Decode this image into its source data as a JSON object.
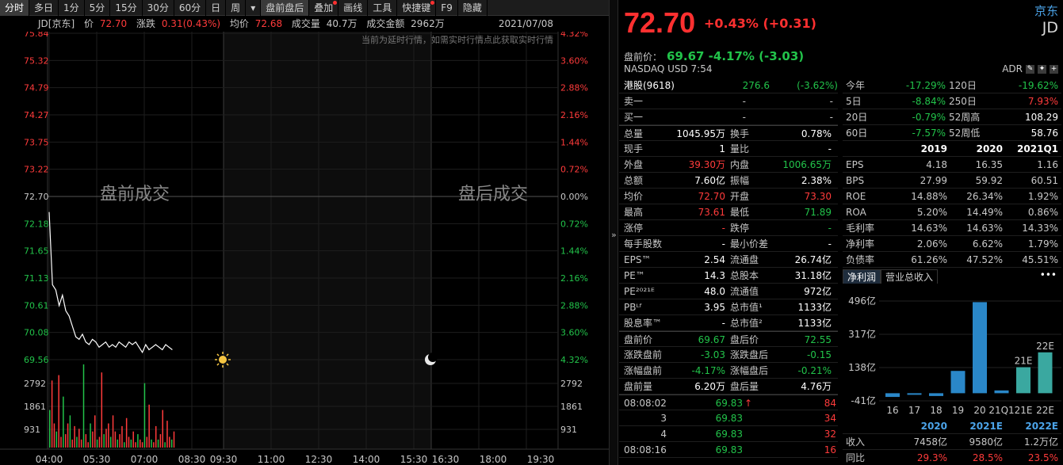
{
  "toolbar": {
    "items": [
      "分时",
      "多日",
      "1分",
      "5分",
      "15分",
      "30分",
      "60分",
      "日",
      "周",
      "▾",
      "盘前盘后",
      "叠加",
      "画线",
      "工具",
      "快捷键",
      "F9",
      "隐藏"
    ]
  },
  "info": {
    "symbol": "JD[京东]",
    "price_label": "价",
    "price": "72.70",
    "change_label": "涨跌",
    "change": "0.31(0.43%)",
    "avg_label": "均价",
    "avg": "72.68",
    "volume_label": "成交量",
    "volume": "40.7万",
    "amount_label": "成交金额",
    "amount": "2962万",
    "date": "2021/07/08",
    "notice": "当前为延时行情，如需实时行情点此获取实时行情"
  },
  "chart_data": {
    "type": "line",
    "title": "",
    "price_ticks": [
      "75.84",
      "75.32",
      "74.79",
      "74.27",
      "73.75",
      "73.22",
      "72.70",
      "72.18",
      "71.65",
      "71.13",
      "70.61",
      "70.08",
      "69.56"
    ],
    "pct_ticks": [
      "4.32%",
      "3.60%",
      "2.88%",
      "2.16%",
      "1.44%",
      "0.72%",
      "0.00%",
      "0.72%",
      "1.44%",
      "2.16%",
      "2.88%",
      "3.60%",
      "4.32%"
    ],
    "vol_ticks": [
      "2792",
      "1861",
      "931"
    ],
    "x_ticks": [
      "04:00",
      "05:30",
      "07:00",
      "08:30",
      "09:30",
      "11:00",
      "12:30",
      "14:00",
      "15:30",
      "16:30",
      "18:00",
      "19:30"
    ],
    "premarket_label": "盘前成交",
    "afterhours_label": "盘后成交",
    "prev_close": 72.7,
    "ylim": [
      69.56,
      75.84
    ],
    "price_series": [
      72.4,
      71.0,
      70.9,
      70.6,
      70.8,
      70.5,
      70.4,
      70.2,
      70.0,
      69.95,
      70.05,
      69.9,
      69.85,
      69.95,
      69.9,
      69.8,
      69.85,
      69.9,
      69.8,
      69.85,
      69.8,
      69.9,
      69.85,
      69.8,
      69.9,
      69.85,
      69.9,
      69.8,
      69.7,
      69.85,
      69.75,
      69.8,
      69.85,
      69.8,
      69.75,
      69.85,
      69.8,
      69.75
    ],
    "volume_bars": [
      1400,
      2500,
      900,
      600,
      2700,
      400,
      1900,
      500,
      900,
      1200,
      300,
      800,
      400,
      700,
      300,
      3100,
      500,
      200,
      900,
      600,
      1200,
      300,
      400,
      2800,
      500,
      700,
      900,
      400,
      1200,
      600,
      300,
      500,
      800,
      200,
      1100,
      400,
      300,
      600,
      200,
      500,
      300,
      200,
      2400,
      400,
      1600,
      300,
      200,
      800,
      300,
      500,
      1400,
      200,
      1000,
      400,
      300,
      600
    ]
  },
  "quote": {
    "name": "京东",
    "code": "JD",
    "price": "72.70",
    "change": "+0.43% (+0.31)",
    "premarket_label": "盘前价：",
    "premarket": "69.67 -4.17% (-3.03)",
    "exchange": "NASDAQ  USD  7:54",
    "adr": "ADR"
  },
  "left_table": [
    [
      {
        "t": "港股(9618)",
        "c": "white"
      },
      {
        "t": "276.6",
        "c": "green"
      },
      {
        "t": "(-3.62%)",
        "c": "green"
      }
    ]
  ],
  "orders": [
    {
      "label": "卖一",
      "v1": "-",
      "v2": "-"
    },
    {
      "label": "买一",
      "v1": "-",
      "v2": "-"
    }
  ],
  "stats": [
    [
      "总量",
      "1045.95万",
      "white",
      "换手",
      "0.78%",
      "white"
    ],
    [
      "现手",
      "1",
      "white",
      "量比",
      "-",
      "white"
    ],
    [
      "外盘",
      "39.30万",
      "red",
      "内盘",
      "1006.65万",
      "green"
    ],
    [
      "总额",
      "7.60亿",
      "white",
      "振幅",
      "2.38%",
      "white"
    ],
    [
      "均价",
      "72.70",
      "red",
      "开盘",
      "73.30",
      "red"
    ],
    [
      "最高",
      "73.61",
      "red",
      "最低",
      "71.89",
      "green"
    ],
    [
      "涨停",
      "-",
      "red",
      "跌停",
      "-",
      "green"
    ],
    [
      "每手股数",
      "-",
      "white",
      "最小价差",
      "-",
      "white"
    ],
    [
      "EPS™",
      "2.54",
      "white",
      "流通盘",
      "26.74亿",
      "white"
    ],
    [
      "PE™",
      "14.3",
      "white",
      "总股本",
      "31.18亿",
      "white"
    ],
    [
      "PE²⁰²¹ᴱ",
      "48.0",
      "white",
      "流通值",
      "972亿",
      "white"
    ],
    [
      "PBᴸᶠ",
      "3.95",
      "white",
      "总市值¹",
      "1133亿",
      "white"
    ],
    [
      "股息率™",
      "-",
      "white",
      "总市值²",
      "1133亿",
      "white"
    ]
  ],
  "extended": [
    [
      "盘前价",
      "69.67",
      "green",
      "盘后价",
      "72.55",
      "green"
    ],
    [
      "涨跌盘前",
      "-3.03",
      "green",
      "涨跌盘后",
      "-0.15",
      "green"
    ],
    [
      "涨幅盘前",
      "-4.17%",
      "green",
      "涨幅盘后",
      "-0.21%",
      "green"
    ],
    [
      "盘前量",
      "6.20万",
      "white",
      "盘后量",
      "4.76万",
      "white"
    ]
  ],
  "ticks": [
    [
      "08:08:02",
      "69.83",
      "↑",
      "84"
    ],
    [
      "3",
      "69.83",
      "",
      "34"
    ],
    [
      "4",
      "69.83",
      "",
      "32"
    ],
    [
      "08:08:16",
      "69.83",
      "",
      "16"
    ]
  ],
  "performance": [
    [
      "今年",
      "-17.29%",
      "green",
      "120日",
      "-19.62%",
      "green"
    ],
    [
      "5日",
      "-8.84%",
      "green",
      "250日",
      "7.93%",
      "red"
    ],
    [
      "20日",
      "-0.79%",
      "green",
      "52周高",
      "108.29",
      "white"
    ],
    [
      "60日",
      "-7.57%",
      "green",
      "52周低",
      "58.76",
      "white"
    ]
  ],
  "fin_headers": [
    "",
    "2019",
    "2020",
    "2021Q1"
  ],
  "financials": [
    [
      "EPS",
      "4.18",
      "16.35",
      "1.16"
    ],
    [
      "BPS",
      "27.99",
      "59.92",
      "60.51"
    ],
    [
      "ROE",
      "14.88%",
      "26.34%",
      "1.92%"
    ],
    [
      "ROA",
      "5.20%",
      "14.49%",
      "0.86%"
    ],
    [
      "毛利率",
      "14.63%",
      "14.63%",
      "14.33%"
    ],
    [
      "净利率",
      "2.06%",
      "6.62%",
      "1.79%"
    ],
    [
      "负债率",
      "61.26%",
      "47.52%",
      "45.51%"
    ]
  ],
  "tabs": [
    "净利润",
    "营业总收入"
  ],
  "bar_chart": {
    "type": "bar",
    "y_ticks": [
      "496亿",
      "317亿",
      "138亿",
      "-41亿"
    ],
    "categories": [
      "16",
      "17",
      "18",
      "19",
      "20",
      "21Q1",
      "21E",
      "22E"
    ],
    "values": [
      -20,
      -2,
      -15,
      120,
      490,
      15,
      140,
      220
    ],
    "estimate_labels": [
      "21E",
      "22E"
    ]
  },
  "forecast_headers": [
    "",
    "2020",
    "2021E",
    "2022E"
  ],
  "forecast": [
    [
      "收入",
      "7458亿",
      "9580亿",
      "1.2万亿"
    ],
    [
      "同比",
      "29.3%",
      "28.5%",
      "23.5%"
    ]
  ]
}
